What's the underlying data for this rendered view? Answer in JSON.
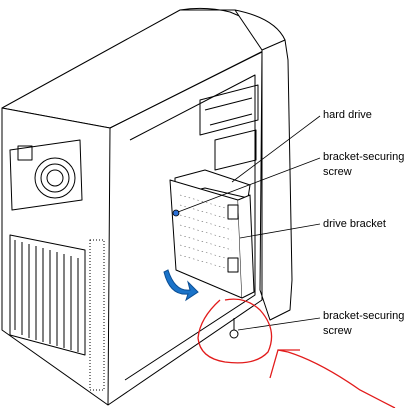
{
  "callouts": {
    "hard_drive": "hard drive",
    "bracket_screw_top": [
      "bracket-securing",
      "screw"
    ],
    "drive_bracket": "drive bracket",
    "bracket_screw_bottom": [
      "bracket-securing",
      "screw"
    ]
  },
  "colors": {
    "line": "#000000",
    "arrow_blue": "#1a73c9",
    "markup_red": "#e21b1b",
    "screw_blue": "#2a6fd6"
  }
}
